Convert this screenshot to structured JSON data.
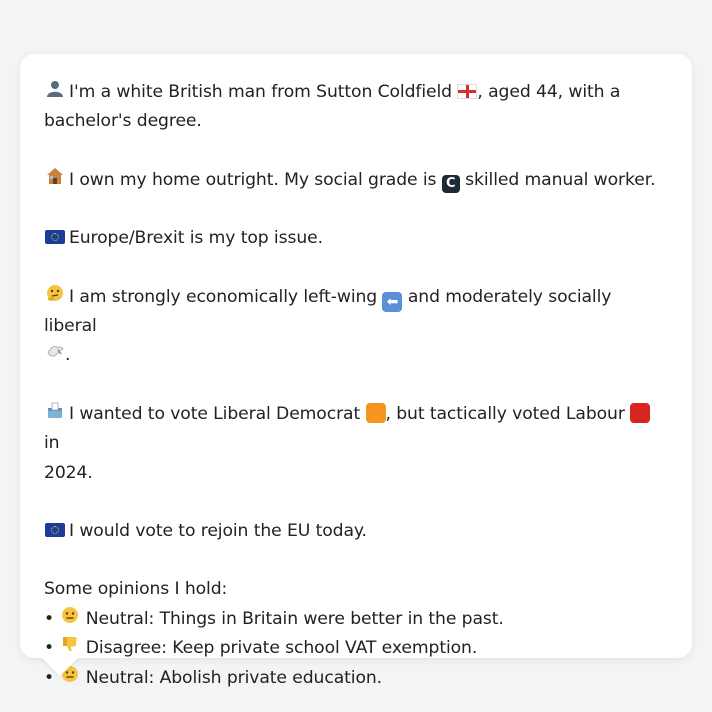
{
  "message": {
    "p1": {
      "icon": "bust-in-silhouette-icon",
      "text_a": "I'm a white British man from Sutton Coldfield",
      "flag": "england-flag-icon",
      "text_b": ", aged 44, with a",
      "line2": "bachelor's degree."
    },
    "p2": {
      "icon": "house-icon",
      "text_a": "I own my home outright. My social grade is",
      "grade_letter": "C",
      "text_b": "skilled manual worker."
    },
    "p3": {
      "icon": "eu-flag-icon",
      "text": "Europe/Brexit is my top issue."
    },
    "p4": {
      "icon": "thinking-face-icon",
      "text_a": "I am strongly economically left-wing",
      "arrow": "left-arrow-icon",
      "text_b": "and moderately socially liberal",
      "line2_suffix": "."
    },
    "p5": {
      "icon": "ballot-box-icon",
      "text_a": "I wanted to vote Liberal Democrat",
      "text_b": ", but tactically voted Labour",
      "text_c": "in",
      "line2": "2024.",
      "colors": {
        "libdem": "#f7941d",
        "labour": "#d7261e"
      }
    },
    "p6": {
      "icon": "eu-flag-icon",
      "text": "I would vote to rejoin the EU today."
    },
    "opinions": {
      "heading": "Some opinions I hold:",
      "items": [
        {
          "bullet": "•",
          "icon": "neutral-face-icon",
          "text": "Neutral: Things in Britain were better in the past."
        },
        {
          "bullet": "•",
          "icon": "thumbs-down-icon",
          "text": "Disagree: Keep private school VAT exemption."
        },
        {
          "bullet": "•",
          "icon": "neutral-face-icon",
          "text": "Neutral: Abolish private education."
        }
      ]
    }
  },
  "colors": {
    "background": "#f3f4f6",
    "card": "#ffffff",
    "text": "#222222"
  }
}
